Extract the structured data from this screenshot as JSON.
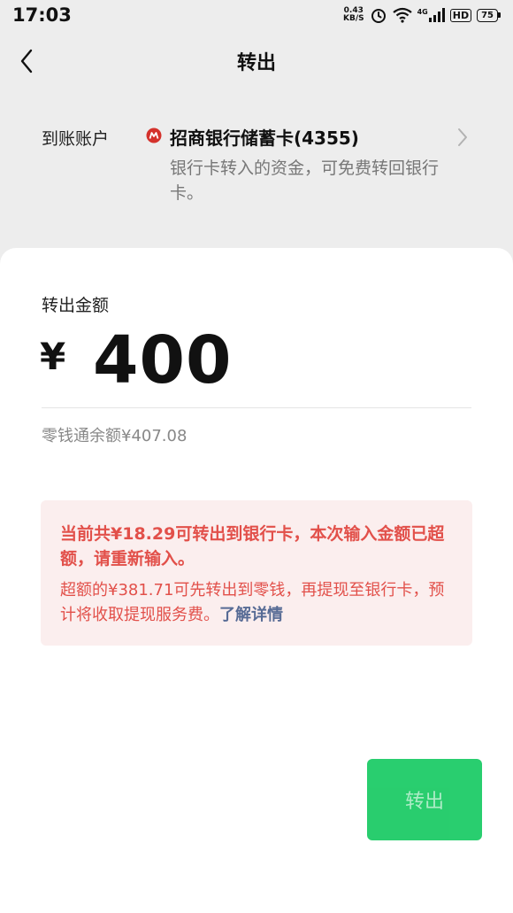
{
  "status_bar": {
    "time": "17:03",
    "net_speed_value": "0.43",
    "net_speed_unit": "KB/S",
    "network_type": "4G",
    "hd_label": "HD",
    "battery_level": "75"
  },
  "header": {
    "title": "转出",
    "back_icon": "chevron-left-icon"
  },
  "account": {
    "label": "到账账户",
    "bank_name": "招商银行储蓄卡(4355)",
    "description": "银行卡转入的资金，可免费转回银行卡。",
    "bank_logo_color": "#d4322c"
  },
  "amount": {
    "label": "转出金额",
    "currency": "¥",
    "value": "400",
    "balance": "零钱通余额¥407.08"
  },
  "error": {
    "main_message": "当前共¥18.29可转出到银行卡，本次输入金额已超额，请重新输入。",
    "detail_message": "超额的¥381.71可先转出到零钱，再提现至银行卡，预计将收取提现服务费。",
    "learn_more": "了解详情",
    "text_color": "#e2504a",
    "link_color": "#576b95",
    "background": "#fbeeee"
  },
  "actions": {
    "submit_label": "转出",
    "submit_color": "#1ecb67"
  }
}
